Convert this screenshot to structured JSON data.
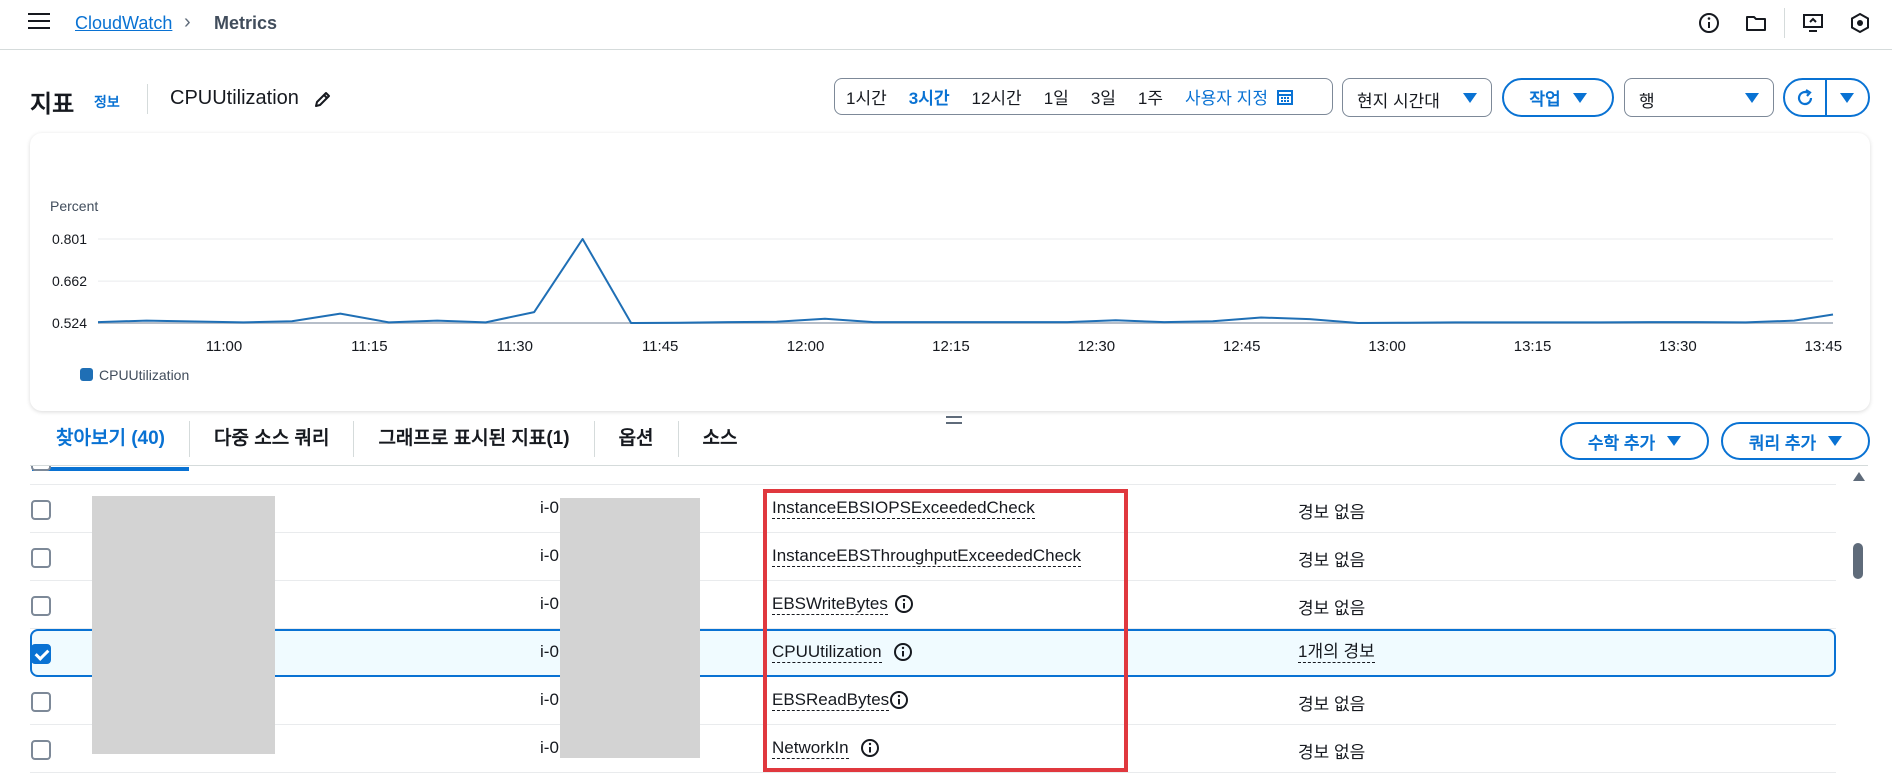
{
  "nav": {
    "breadcrumb_root": "CloudWatch",
    "breadcrumb_current": "Metrics",
    "icons": [
      "info-icon",
      "folder-icon",
      "monitor-icon",
      "settings-hex-icon"
    ]
  },
  "header": {
    "title": "지표",
    "info_link": "정보",
    "metric_name": "CPUUtilization"
  },
  "time_ranges": {
    "items": [
      "1시간",
      "3시간",
      "12시간",
      "1일",
      "3일",
      "1주"
    ],
    "active": "3시간",
    "custom": "사용자 지정"
  },
  "controls": {
    "timezone": "현지 시간대",
    "actions": "작업",
    "view_select": "행"
  },
  "chart_data": {
    "type": "line",
    "ylabel": "Percent",
    "y_ticks": [
      "0.801",
      "0.662",
      "0.524"
    ],
    "ylim": [
      0.524,
      0.801
    ],
    "x_ticks": [
      "11:00",
      "11:15",
      "11:30",
      "11:45",
      "12:00",
      "12:15",
      "12:30",
      "12:45",
      "13:00",
      "13:15",
      "13:30",
      "13:45"
    ],
    "x_range": [
      "10:47",
      "13:46"
    ],
    "series": [
      {
        "name": "CPUUtilization",
        "color": "#1f6fb5",
        "x": [
          "10:47",
          "10:52",
          "10:57",
          "11:02",
          "11:07",
          "11:12",
          "11:17",
          "11:22",
          "11:27",
          "11:32",
          "11:37",
          "11:42",
          "11:47",
          "11:52",
          "11:57",
          "12:02",
          "12:07",
          "12:12",
          "12:17",
          "12:22",
          "12:27",
          "12:32",
          "12:37",
          "12:42",
          "12:47",
          "12:52",
          "12:57",
          "13:02",
          "13:07",
          "13:12",
          "13:17",
          "13:22",
          "13:27",
          "13:32",
          "13:37",
          "13:42",
          "13:46"
        ],
        "y": [
          0.527,
          0.532,
          0.529,
          0.526,
          0.53,
          0.555,
          0.526,
          0.532,
          0.526,
          0.56,
          0.801,
          0.524,
          0.525,
          0.527,
          0.528,
          0.538,
          0.527,
          0.527,
          0.527,
          0.527,
          0.527,
          0.533,
          0.527,
          0.53,
          0.542,
          0.537,
          0.524,
          0.525,
          0.526,
          0.526,
          0.526,
          0.526,
          0.527,
          0.527,
          0.526,
          0.532,
          0.552
        ]
      }
    ],
    "grid": true,
    "legend": "bottom-left"
  },
  "tabs": [
    {
      "label": "찾아보기 (40)",
      "active": true
    },
    {
      "label": "다중 소스 쿼리",
      "active": false
    },
    {
      "label": "그래프로 표시된 지표(1)",
      "active": false
    },
    {
      "label": "옵션",
      "active": false
    },
    {
      "label": "소스",
      "active": false
    }
  ],
  "table_actions": {
    "add_math": "수학 추가",
    "add_query": "쿼리 추가"
  },
  "rows": [
    {
      "instance": "i-0",
      "metric": "InstanceEBSIOPSExceededCheck",
      "has_info": false,
      "alarm": "경보 없음",
      "checked": false
    },
    {
      "instance": "i-0",
      "metric": "InstanceEBSThroughputExceededCheck",
      "has_info": false,
      "alarm": "경보 없음",
      "checked": false
    },
    {
      "instance": "i-0",
      "metric": "EBSWriteBytes",
      "has_info": true,
      "alarm": "경보 없음",
      "checked": false
    },
    {
      "instance": "i-0",
      "metric": "CPUUtilization",
      "has_info": true,
      "alarm": "1개의 경보",
      "checked": true
    },
    {
      "instance": "i-0",
      "metric": "EBSReadBytes",
      "has_info": true,
      "alarm": "경보 없음",
      "checked": false
    },
    {
      "instance": "i-0",
      "metric": "NetworkIn",
      "has_info": true,
      "alarm": "경보 없음",
      "checked": false
    }
  ]
}
